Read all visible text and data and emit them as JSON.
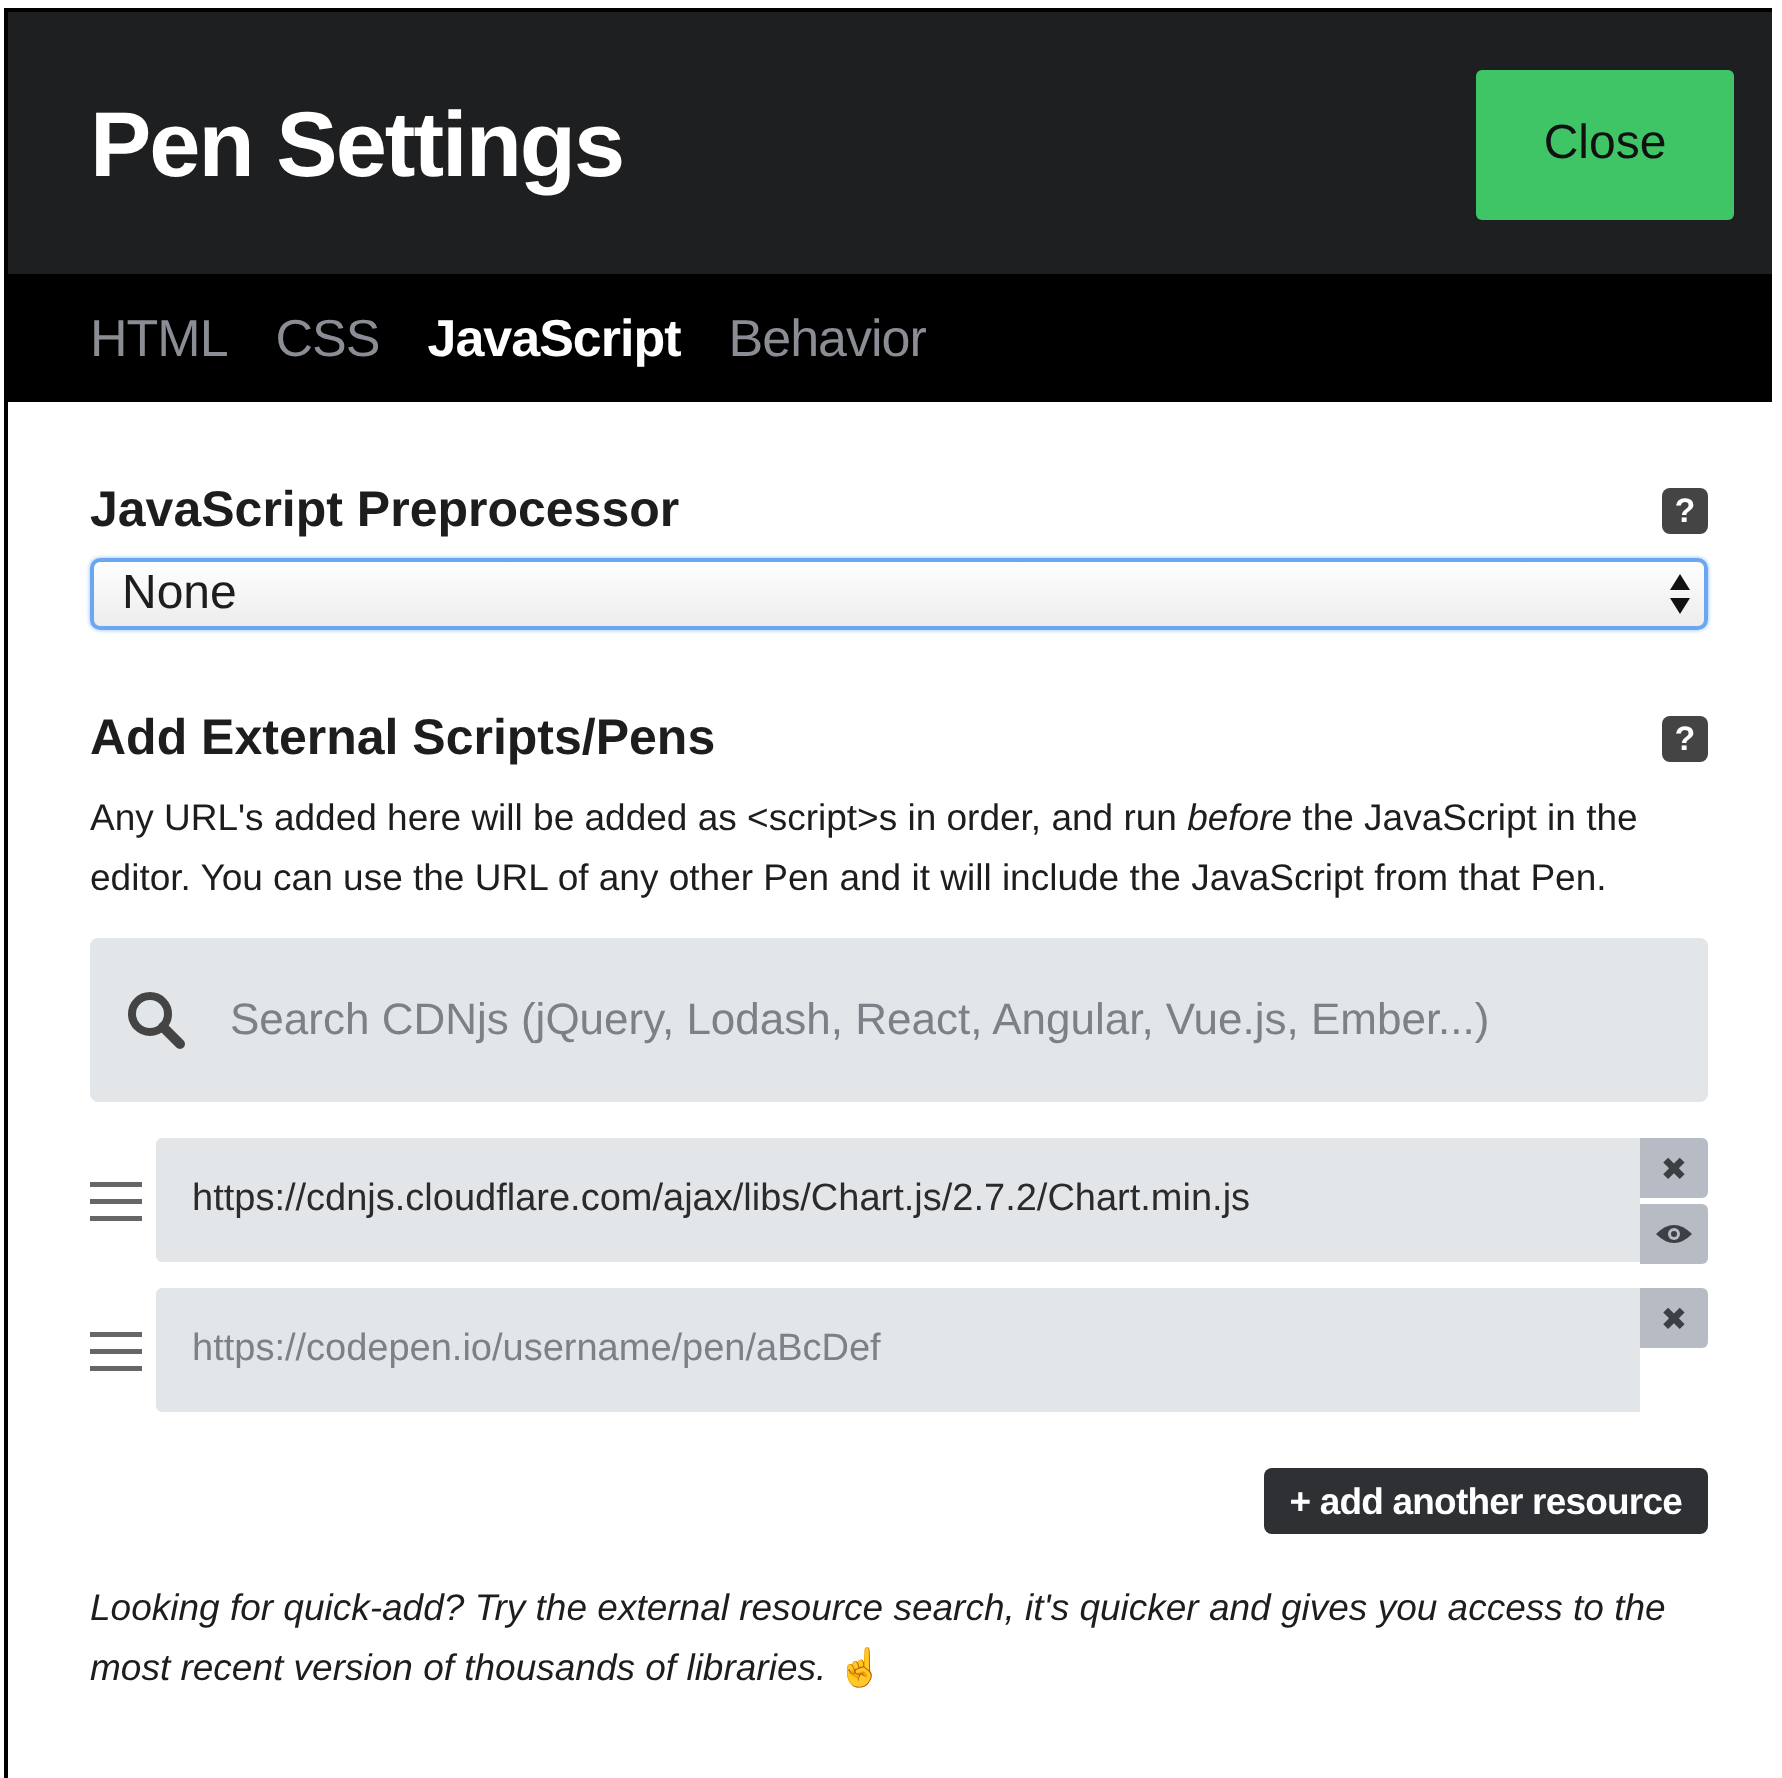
{
  "window": {
    "title": "Pen Settings",
    "close_button": "Close"
  },
  "tabs": [
    {
      "label": "HTML",
      "selected": false
    },
    {
      "label": "CSS",
      "selected": false
    },
    {
      "label": "JavaScript",
      "selected": true
    },
    {
      "label": "Behavior",
      "selected": false
    }
  ],
  "preprocessor": {
    "heading": "JavaScript Preprocessor",
    "help": "?",
    "value": "None"
  },
  "external": {
    "heading": "Add External Scripts/Pens",
    "help": "?",
    "description": "Any URL's added here will be added as <script>s in order, and run *before* the JavaScript in the editor. You can use the URL of any other Pen and it will include the JavaScript from that Pen.",
    "search": {
      "placeholder": "Search CDNjs (jQuery, Lodash, React, Angular, Vue.js, Ember...)"
    },
    "resources": [
      {
        "value": "https://cdnjs.cloudflare.com/ajax/libs/Chart.js/2.7.2/Chart.min.js",
        "remove": "✖",
        "preview": true
      },
      {
        "placeholder": "https://codepen.io/username/pen/aBcDef",
        "remove": "✖",
        "preview": false
      }
    ],
    "add_button": "+ add another resource",
    "tip": "*Looking for quick-add? Try the external resource search, it's quicker and gives you access to the most recent version of thousands of libraries.* ☝"
  }
}
